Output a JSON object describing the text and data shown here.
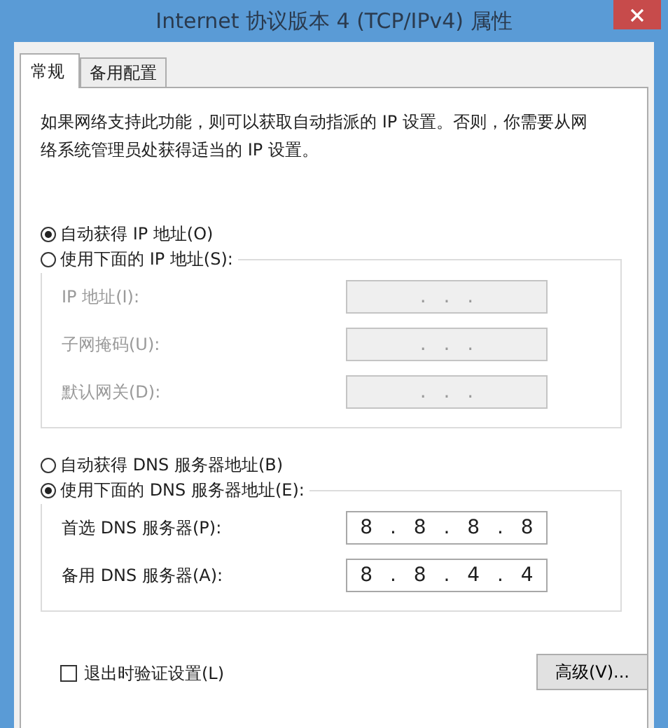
{
  "window": {
    "title": "Internet 协议版本 4 (TCP/IPv4) 属性"
  },
  "tabs": [
    {
      "label": "常规",
      "selected": true
    },
    {
      "label": "备用配置",
      "selected": false
    }
  ],
  "description": "如果网络支持此功能，则可以获取自动指派的 IP 设置。否则，你需要从网络系统管理员处获得适当的 IP 设置。",
  "ip_section": {
    "auto_radio": {
      "label": "自动获得 IP 地址(O)",
      "selected": true
    },
    "manual_radio": {
      "label": "使用下面的 IP 地址(S):",
      "selected": false
    },
    "fields": [
      {
        "label": "IP 地址(I):",
        "value": ". . .",
        "disabled": true
      },
      {
        "label": "子网掩码(U):",
        "value": ". . .",
        "disabled": true
      },
      {
        "label": "默认网关(D):",
        "value": ". . .",
        "disabled": true
      }
    ]
  },
  "dns_section": {
    "auto_radio": {
      "label": "自动获得 DNS 服务器地址(B)",
      "selected": false
    },
    "manual_radio": {
      "label": "使用下面的 DNS 服务器地址(E):",
      "selected": true
    },
    "fields": [
      {
        "label": "首选 DNS 服务器(P):",
        "value": "8 . 8 . 8 . 8",
        "disabled": false
      },
      {
        "label": "备用 DNS 服务器(A):",
        "value": "8 . 8 . 4 . 4",
        "disabled": false
      }
    ]
  },
  "validate_checkbox": {
    "label": "退出时验证设置(L)",
    "checked": false
  },
  "advanced_button": "高级(V)..."
}
